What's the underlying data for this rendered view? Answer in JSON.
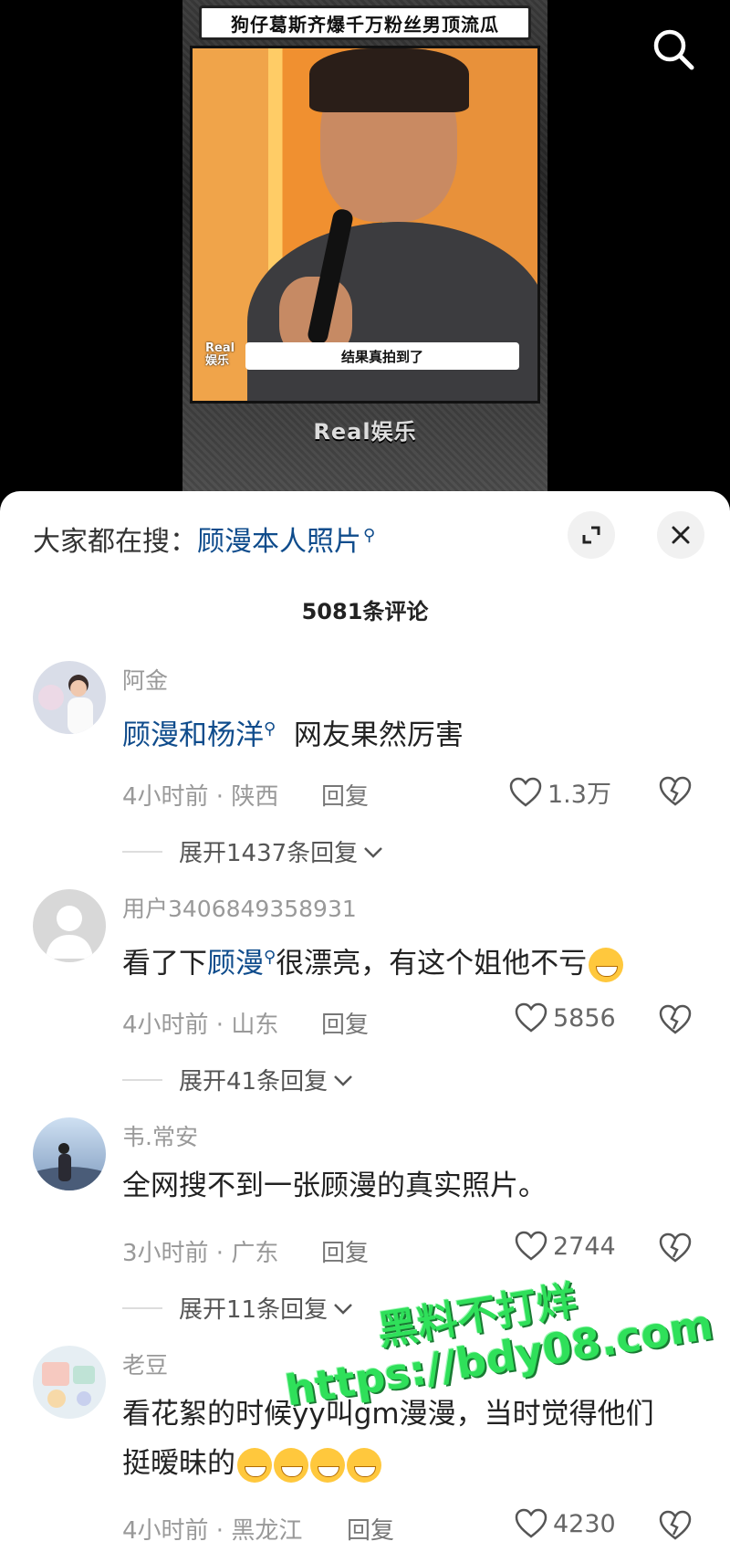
{
  "video": {
    "title": "狗仔葛斯齐爆千万粉丝男顶流瓜",
    "caption": "结果真拍到了",
    "small_watermark_line1": "Real",
    "small_watermark_line2": "娱乐",
    "brand": "Real娱乐",
    "search_icon": "search-icon"
  },
  "sheet": {
    "hot_prefix": "大家都在搜：",
    "hot_keyword": "顾漫本人照片",
    "expand_icon": "expand-icon",
    "close_icon": "close-icon",
    "comment_count": "5081条评论"
  },
  "comments": [
    {
      "user": "阿金",
      "text_kw": "顾漫和杨洋",
      "text_rest": "网友果然厉害",
      "meta": "4小时前 · 陕西",
      "reply": "回复",
      "likes": "1.3万",
      "expand": "展开1437条回复"
    },
    {
      "user": "用户3406849358931",
      "text_pre": "看了下",
      "text_kw": "顾漫",
      "text_rest": "很漂亮，有这个姐他不亏",
      "meta": "4小时前 · 山东",
      "reply": "回复",
      "likes": "5856",
      "expand": "展开41条回复"
    },
    {
      "user": "韦.常安",
      "text": "全网搜不到一张顾漫的真实照片。",
      "meta": "3小时前 · 广东",
      "reply": "回复",
      "likes": "2744",
      "expand": "展开11条回复"
    },
    {
      "user": "老豆",
      "text_line1": "看花絮的时候yy叫gm漫漫，当时觉得他们",
      "text_line2": "挺暧昧的",
      "meta": "4小时前 · 黑龙江",
      "reply": "回复",
      "likes": "4230"
    }
  ],
  "watermark": {
    "line1": "黑料不打烊",
    "line2": "https://bdy08.com"
  },
  "colors": {
    "keyword": "#0f4c8c",
    "watermark": "#2fe05a"
  }
}
